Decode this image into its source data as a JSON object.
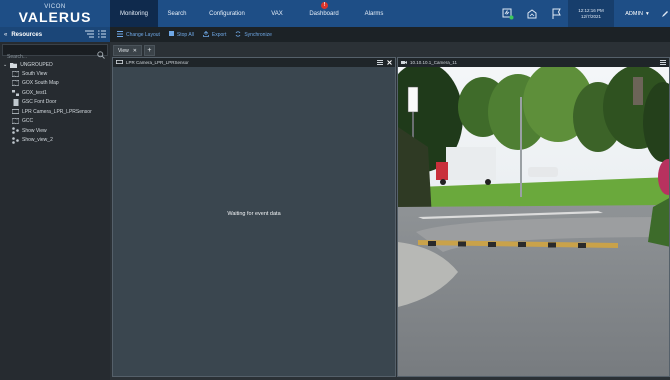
{
  "brand": {
    "small": "VICON",
    "name": "VALERUS"
  },
  "nav": {
    "tabs": [
      "Monitoring",
      "Search",
      "Configuration",
      "VAX",
      "Dashboard",
      "Alarms"
    ],
    "active_index": 0,
    "dashboard_alert": "!"
  },
  "header": {
    "time": "12:12:16 PM",
    "date": "12/7/2021",
    "user": "ADMIN"
  },
  "sidebar": {
    "title": "Resources",
    "search_placeholder": "Search...",
    "group": "UNGROUPED",
    "items": [
      {
        "label": "South View",
        "icon": "map-icon"
      },
      {
        "label": "GOX South Map",
        "icon": "map-icon"
      },
      {
        "label": "GOX_test1",
        "icon": "camera-group-icon"
      },
      {
        "label": "GSC Font Door",
        "icon": "door-icon"
      },
      {
        "label": "LPR Camera_LPR_LPRSensor",
        "icon": "lpr-sensor-icon"
      },
      {
        "label": "GCC",
        "icon": "map-icon"
      },
      {
        "label": "Show View",
        "icon": "view-icon"
      },
      {
        "label": "Show_view_2",
        "icon": "view-icon"
      }
    ]
  },
  "toolbar": {
    "change_layout": "Change Layout",
    "stop_all": "Stop All",
    "export": "Export",
    "synchronize": "Synchronize"
  },
  "view_tabs": {
    "tab_label": "View",
    "add_label": "+"
  },
  "panes": {
    "left_title": "LPR Camera_LPR_LPRSensor",
    "left_message": "Waiting for event data",
    "right_title": "10.10.10.1_Camera_11"
  },
  "colors": {
    "topbar": "#1e4e86",
    "accent_link": "#6fa8e6",
    "alert": "#d9342b"
  }
}
